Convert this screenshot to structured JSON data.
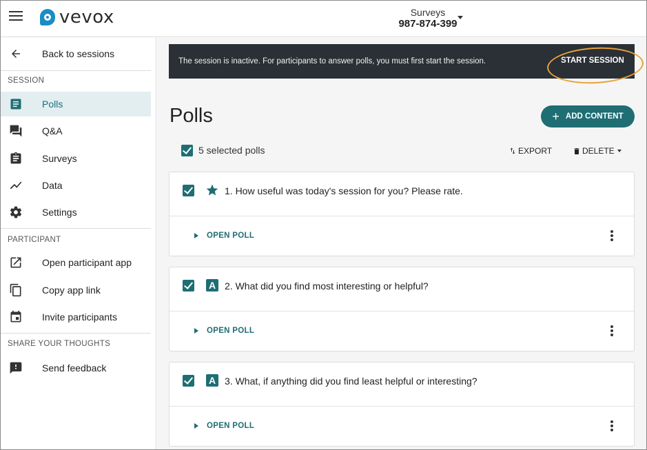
{
  "header": {
    "logo_text": "vevox",
    "session_title": "Surveys",
    "session_code": "987-874-399"
  },
  "sidebar": {
    "back_label": "Back to sessions",
    "section_session": "SESSION",
    "session_items": [
      {
        "label": "Polls",
        "icon": "polls-icon",
        "active": true
      },
      {
        "label": "Q&A",
        "icon": "qa-icon"
      },
      {
        "label": "Surveys",
        "icon": "surveys-icon"
      },
      {
        "label": "Data",
        "icon": "data-icon"
      },
      {
        "label": "Settings",
        "icon": "gear-icon"
      }
    ],
    "section_participant": "PARTICIPANT",
    "participant_items": [
      {
        "label": "Open participant app",
        "icon": "open-external-icon"
      },
      {
        "label": "Copy app link",
        "icon": "copy-icon"
      },
      {
        "label": "Invite participants",
        "icon": "calendar-icon"
      }
    ],
    "section_feedback": "SHARE YOUR THOUGHTS",
    "feedback_items": [
      {
        "label": "Send feedback",
        "icon": "feedback-icon"
      }
    ]
  },
  "banner": {
    "message": "The session is inactive. For participants to answer polls, you must first start the session.",
    "start_label": "START SESSION",
    "highlight_color": "#e8a23a"
  },
  "main": {
    "title": "Polls",
    "add_content_label": "ADD CONTENT",
    "selected_text": "5 selected polls",
    "export_label": "EXPORT",
    "delete_label": "DELETE",
    "accent_color": "#1e6e74"
  },
  "polls": [
    {
      "question": "1. How useful was today's session for you? Please rate.",
      "type": "star-icon",
      "open_label": "OPEN POLL"
    },
    {
      "question": "2. What did you find most interesting or helpful?",
      "type": "text-icon",
      "type_glyph": "A",
      "open_label": "OPEN POLL"
    },
    {
      "question": "3. What, if anything did you find least helpful or interesting?",
      "type": "text-icon",
      "type_glyph": "A",
      "open_label": "OPEN POLL"
    }
  ]
}
